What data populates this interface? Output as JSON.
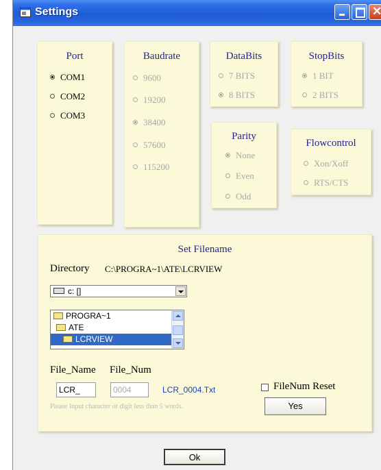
{
  "window": {
    "title": "Settings"
  },
  "port": {
    "title": "Port",
    "options": [
      {
        "label": "COM1",
        "selected": true
      },
      {
        "label": "COM2",
        "selected": false
      },
      {
        "label": "COM3",
        "selected": false
      }
    ]
  },
  "baudrate": {
    "title": "Baudrate",
    "options": [
      {
        "label": "9600",
        "selected": false
      },
      {
        "label": "19200",
        "selected": false
      },
      {
        "label": "38400",
        "selected": true
      },
      {
        "label": "57600",
        "selected": false
      },
      {
        "label": "115200",
        "selected": false
      }
    ]
  },
  "databits": {
    "title": "DataBits",
    "options": [
      {
        "label": "7 BITS",
        "selected": false
      },
      {
        "label": "8 BITS",
        "selected": true
      }
    ]
  },
  "stopbits": {
    "title": "StopBits",
    "options": [
      {
        "label": "1 BIT",
        "selected": true
      },
      {
        "label": "2 BITS",
        "selected": false
      }
    ]
  },
  "parity": {
    "title": "Parity",
    "options": [
      {
        "label": "None",
        "selected": true
      },
      {
        "label": "Even",
        "selected": false
      },
      {
        "label": "Odd",
        "selected": false
      }
    ]
  },
  "flowcontrol": {
    "title": "Flowcontrol",
    "options": [
      {
        "label": "Xon/Xoff",
        "selected": false
      },
      {
        "label": "RTS/CTS",
        "selected": false
      }
    ]
  },
  "filename": {
    "title": "Set Filename",
    "directory_label": "Directory",
    "directory_path": "C:\\PROGRA~1\\ATE\\LCRVIEW",
    "drive": "c: []",
    "dirs": [
      {
        "label": "PROGRA~1",
        "selected": false
      },
      {
        "label": "ATE",
        "selected": false
      },
      {
        "label": "LCRVIEW",
        "selected": true
      }
    ],
    "file_name_label": "File_Name",
    "file_num_label": "File_Num",
    "file_name_value": "LCR_",
    "file_num_value": "0004",
    "preview": "LCR_0004.Txt",
    "reset_label": "FileNum Reset",
    "reset_checked": false,
    "hint": "Please Input character or digit less than 5 words.",
    "yes_label": "Yes"
  },
  "ok_label": "Ok",
  "colors": {
    "title_bar": "#2a64dc",
    "panel": "#fbf9d8",
    "heading": "#23238e",
    "preview": "#1a3fb0"
  }
}
